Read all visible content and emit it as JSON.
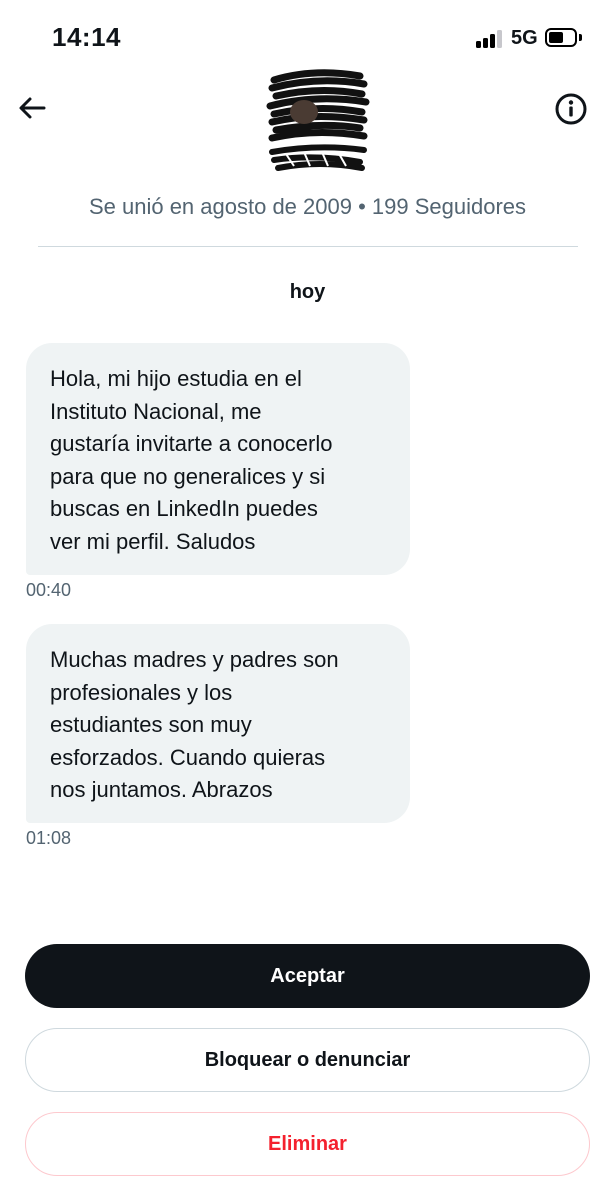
{
  "status_bar": {
    "time": "14:14",
    "network": "5G",
    "signal_bars_active": 3,
    "signal_bars_total": 4,
    "battery_level": 0.45
  },
  "header": {
    "back_icon": "arrow-left-icon",
    "info_icon": "info-circle-icon",
    "avatar": "redacted-avatar"
  },
  "profile": {
    "meta": "Se unió en agosto de 2009 • 199 Seguidores"
  },
  "conversation": {
    "day_label": "hoy",
    "messages": [
      {
        "text": "Hola, mi hijo estudia en el\nInstituto Nacional, me\ngustaría invitarte a conocerlo\npara que no generalices y si\nbuscas en LinkedIn puedes\nver mi perfil. Saludos",
        "time": "00:40"
      },
      {
        "text": "Muchas madres y padres son\nprofesionales y los\nestudiantes son muy\nesforzados. Cuando quieras\nnos juntamos. Abrazos",
        "time": "01:08"
      }
    ]
  },
  "actions": {
    "accept_label": "Aceptar",
    "block_label": "Bloquear o denunciar",
    "delete_label": "Eliminar"
  },
  "colors": {
    "text_primary": "#0f1419",
    "text_secondary": "#536471",
    "bubble_bg": "#eff3f4",
    "danger": "#f4212e",
    "border": "#cfd9de"
  }
}
